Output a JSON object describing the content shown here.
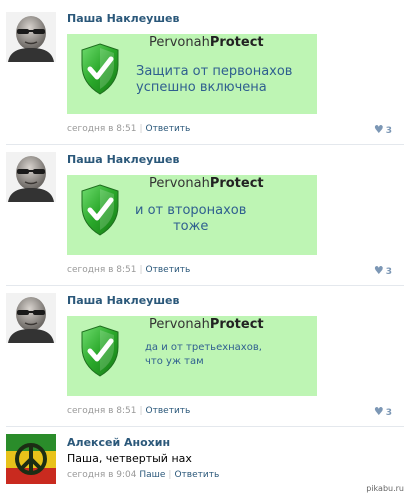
{
  "comments": [
    {
      "author": "Паша Наклеушев",
      "brand_light": "Pervonah",
      "brand_bold": "Protect",
      "message_line1": "Защита от первонахов",
      "message_line2": "успешно включена",
      "time": "сегодня в 8:51",
      "reply_label": "Ответить",
      "likes": "3"
    },
    {
      "author": "Паша Наклеушев",
      "brand_light": "Pervonah",
      "brand_bold": "Protect",
      "message_line1": "и от второнахов",
      "message_line2": "тоже",
      "time": "сегодня в 8:51",
      "reply_label": "Ответить",
      "likes": "3"
    },
    {
      "author": "Паша Наклеушев",
      "brand_light": "Pervonah",
      "brand_bold": "Protect",
      "message_line1": "да и от третьехнахов,",
      "message_line2": "что уж там",
      "time": "сегодня в 8:51",
      "reply_label": "Ответить",
      "likes": "3"
    },
    {
      "author": "Алексей Анохин",
      "text": "Паша, четвертый нах",
      "time": "сегодня в 9:04",
      "reply_to": "Паше",
      "reply_label": "Ответить"
    }
  ],
  "watermark": "pikabu.ru",
  "colors": {
    "author_link": "#2b587a",
    "card_background": "#bef5b4",
    "card_text": "#2f5f8f",
    "shield_green": "#2aa82a",
    "like_heart": "#7c97b5"
  },
  "icons": {
    "shield": "shield-check-icon",
    "like": "heart-icon",
    "avatar_rasta": "peace-symbol-icon"
  }
}
